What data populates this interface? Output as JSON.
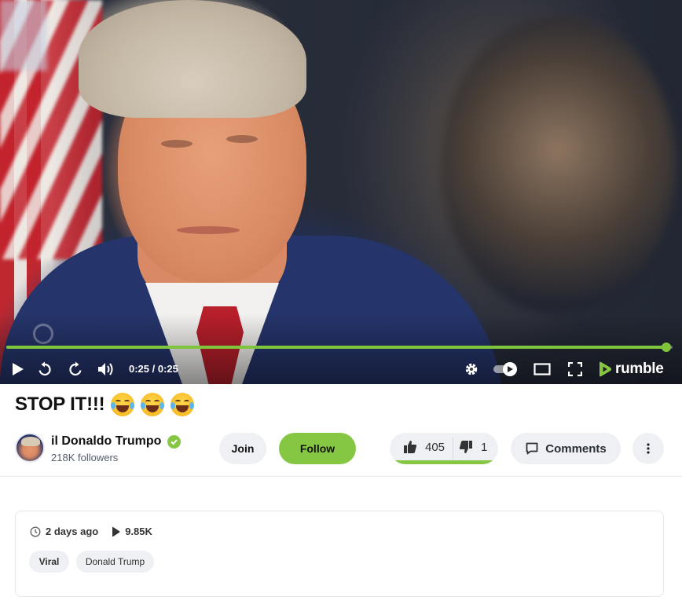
{
  "player": {
    "time_display": "0:25 / 0:25",
    "progress_fraction": 0.99,
    "brand": "rumble",
    "accent_color": "#85c742"
  },
  "video": {
    "title": "STOP IT!!!",
    "title_emoji_icons": [
      "face-with-tears-of-joy-icon",
      "face-with-tears-of-joy-icon",
      "face-with-tears-of-joy-icon"
    ]
  },
  "channel": {
    "name": "il Donaldo Trumpo",
    "followers": "218K followers",
    "verified_icon": "verified-check-icon"
  },
  "actions": {
    "join_label": "Join",
    "follow_label": "Follow",
    "upvotes": "405",
    "downvotes": "1",
    "upvote_fraction": 0.98,
    "comments_label": "Comments"
  },
  "details": {
    "posted": "2 days ago",
    "views": "9.85K",
    "tags": [
      "Viral",
      "Donald Trump"
    ]
  }
}
